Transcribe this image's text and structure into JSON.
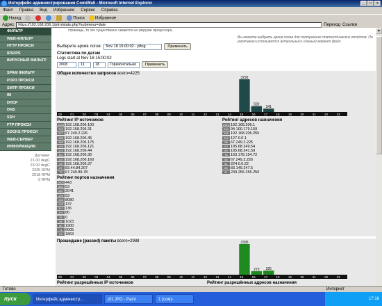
{
  "window": {
    "title": "Интерфейс администрирования ComiWall - Microsoft Internet Explorer"
  },
  "menu": [
    "Файл",
    "Правка",
    "Вид",
    "Избранное",
    "Сервис",
    "Справка"
  ],
  "toolbar": {
    "back": "Назад",
    "search": "Поиск",
    "favorites": "Избранное"
  },
  "address": {
    "label": "Адрес",
    "value": "https://192.168.206.1/pfrn/stats.php?submenu=date",
    "go": "Переход",
    "links": "Ссылки"
  },
  "sidebar": {
    "items": [
      {
        "label": "ФИЛЬТР",
        "active": true
      },
      {
        "label": "WEB-ФИЛЬТР"
      },
      {
        "label": "HTTP ПРОКСИ"
      },
      {
        "label": "IDS/IPS"
      },
      {
        "label": "ВИРУСНЫЙ ФИЛЬТР",
        "tall": true
      },
      {
        "label": "SPAM ФИЛЬТР"
      },
      {
        "label": "POP3 ПРОКСИ"
      },
      {
        "label": "SMTP ПРОКСИ"
      },
      {
        "label": "IM"
      },
      {
        "label": "DHCP"
      },
      {
        "label": "DNS"
      },
      {
        "label": "SSH"
      },
      {
        "label": "FTP ПРОКСИ"
      },
      {
        "label": "SOCKS ПРОКСИ"
      },
      {
        "label": "WEB-СЕРВЕР"
      },
      {
        "label": "ИНФОРМАЦИЯ"
      }
    ],
    "sensors_title": "Датчики:",
    "sensors": [
      "21.00 degC",
      "23.00 degC",
      "2335 RPM",
      "2518 RPM",
      "0 RPM"
    ]
  },
  "main": {
    "notice_left": "страницы, то это существенно скажется на загрузке процессора.",
    "notice_right": "Вы можете выбрать архив логов для построения статистических отчётов. По умолчанию используется актуальный и данный момент файл.",
    "archive_label": "Выберите архив логов:",
    "archive_value": "Nov 18 15:00:02 - pflog",
    "apply": "Применить",
    "stats_title": "Статистика по датам",
    "logs_start": "Logs start at Nov 18 15:00:02",
    "date": {
      "year": "2008",
      "month": "11",
      "day": "18",
      "orientation": "Горизонтально"
    }
  },
  "chart_data": [
    {
      "type": "bar",
      "title": "Общее количество запросов",
      "total_label": "всего=",
      "total": "4225",
      "categories": [
        "00",
        "01",
        "02",
        "03",
        "04",
        "05",
        "06",
        "07",
        "08",
        "09",
        "10",
        "11",
        "12",
        "13",
        "14",
        "15",
        "16",
        "17",
        "18",
        "19",
        "20",
        "21",
        "22",
        "23"
      ],
      "values": [
        0,
        0,
        0,
        0,
        0,
        0,
        0,
        0,
        0,
        0,
        0,
        0,
        0,
        0,
        0,
        3292,
        592,
        341,
        0,
        0,
        0,
        0,
        0,
        0
      ],
      "value_labels": [
        "",
        "",
        "",
        "",
        "",
        "",
        "",
        "",
        "",
        "",
        "",
        "",
        "",
        "",
        "",
        "3292",
        "592",
        "341",
        "",
        "",
        "",
        "",
        "",
        ""
      ],
      "color": "#204a4a"
    },
    {
      "type": "bar",
      "title": "Прошедшие (passed) пакеты",
      "total_label": "всего=",
      "total": "2988",
      "categories": [
        "00",
        "01",
        "02",
        "03",
        "04",
        "05",
        "06",
        "07",
        "08",
        "09",
        "10",
        "11",
        "12",
        "13",
        "14",
        "15",
        "16",
        "17",
        "18",
        "19",
        "20",
        "21",
        "22",
        "23"
      ],
      "values": [
        0,
        0,
        0,
        0,
        0,
        0,
        0,
        0,
        0,
        0,
        0,
        0,
        0,
        0,
        0,
        2395,
        273,
        325,
        0,
        0,
        0,
        0,
        0,
        0
      ],
      "value_labels": [
        "",
        "",
        "",
        "",
        "",
        "",
        "",
        "",
        "",
        "",
        "",
        "",
        "",
        "",
        "",
        "2395",
        "273",
        "325",
        "",
        "",
        "",
        "",
        "",
        ""
      ],
      "color": "#1f8a1f"
    }
  ],
  "lists": {
    "src_ip": {
      "title": "Рейтинг IP источников",
      "rows": [
        {
          "c": "1044",
          "v": "192.168.206.100"
        },
        {
          "c": "702",
          "v": "192.168.206.31"
        },
        {
          "c": "377",
          "v": "67.249.2.226"
        },
        {
          "c": "186",
          "v": "192.168.206.45"
        },
        {
          "c": "183",
          "v": "192.168.206.175"
        },
        {
          "c": "130",
          "v": "192.168.206.121"
        },
        {
          "c": "123",
          "v": "192.168.206.44"
        },
        {
          "c": "111",
          "v": "192.168.206.36"
        },
        {
          "c": "104",
          "v": "192.168.206.160"
        },
        {
          "c": "98",
          "v": "192.168.206.37"
        },
        {
          "c": "87",
          "v": "83.44.84.207"
        },
        {
          "c": "73",
          "v": "67.240.89.78"
        }
      ]
    },
    "dst_addr": {
      "title": "Рейтинг адресов назначения",
      "rows": [
        {
          "c": "2322",
          "v": "192.168.206.1"
        },
        {
          "c": "240",
          "v": "94.100.179.159"
        },
        {
          "c": "165",
          "v": "192.168.206.255"
        },
        {
          "c": "102",
          "v": "127.0.0.1"
        },
        {
          "c": "98",
          "v": "67.249.2.225"
        },
        {
          "c": "92",
          "v": "195.68.249.54"
        },
        {
          "c": "89",
          "v": "195.68.241.59"
        },
        {
          "c": "76",
          "v": "193.178.154.72"
        },
        {
          "c": "68",
          "v": "67.249.2.226"
        },
        {
          "c": "61",
          "v": "224.0.0.22"
        },
        {
          "c": "55",
          "v": "83.149.247.5"
        },
        {
          "c": "41",
          "v": "239.255.255.250"
        }
      ]
    },
    "dst_ports": {
      "title": "Рейтинг портов назначения",
      "rows": [
        {
          "c": "1802",
          "v": "443"
        },
        {
          "c": "554",
          "v": "53"
        },
        {
          "c": "287",
          "v": "2041"
        },
        {
          "c": "199",
          "v": "53"
        },
        {
          "c": "165",
          "v": "8080"
        },
        {
          "c": "133",
          "v": "137"
        },
        {
          "c": "112",
          "v": "136"
        },
        {
          "c": "101",
          "v": "80"
        },
        {
          "c": "95",
          "v": "0"
        },
        {
          "c": "88",
          "v": "1023"
        },
        {
          "c": "80",
          "v": "1900"
        },
        {
          "c": "71",
          "v": "6005"
        },
        {
          "c": "64",
          "v": "1863"
        }
      ]
    },
    "allowed_src": {
      "title": "Рейтинг разрешённых IP источников",
      "rows": [
        {
          "c": "1044",
          "v": "192.168.206.100"
        }
      ]
    },
    "allowed_dst": {
      "title": "Рейтинг разрешённых адресов назначения",
      "rows": [
        {
          "c": "2322",
          "v": "192.168.206.1"
        }
      ]
    }
  },
  "statusbar": {
    "text": "Готово",
    "zone": "Интернет"
  },
  "taskbar": {
    "start": "пуск",
    "tasks": [
      "Интерфейс администр...",
      "pf1.JPG - Paint",
      "1 (сом)-"
    ],
    "clock": "17:16"
  }
}
